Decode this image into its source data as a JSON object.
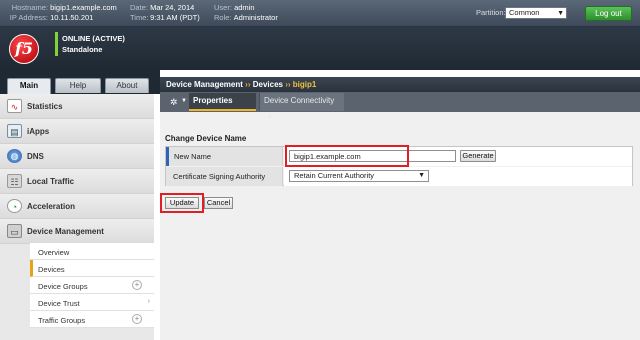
{
  "header": {
    "hostname_label": "Hostname:",
    "hostname": "bigip1.example.com",
    "ip_label": "IP Address:",
    "ip": "10.11.50.201",
    "date_label": "Date:",
    "date": "Mar 24, 2014",
    "time_label": "Time:",
    "time": "9:31 AM (PDT)",
    "user_label": "User:",
    "user": "admin",
    "role_label": "Role:",
    "role": "Administrator",
    "partition_label": "Partition:",
    "partition_value": "Common",
    "logout_label": "Log out"
  },
  "status": {
    "logo_text": "f5",
    "line1": "ONLINE (ACTIVE)",
    "line2": "Standalone"
  },
  "tabs": [
    {
      "label": "Main",
      "active": true
    },
    {
      "label": "Help",
      "active": false
    },
    {
      "label": "About",
      "active": false
    }
  ],
  "sidebar": {
    "items": [
      {
        "label": "Statistics",
        "icon": "chart-icon"
      },
      {
        "label": "iApps",
        "icon": "iapps-icon"
      },
      {
        "label": "DNS",
        "icon": "globe-icon"
      },
      {
        "label": "Local Traffic",
        "icon": "traffic-icon"
      },
      {
        "label": "Acceleration",
        "icon": "gauge-icon"
      },
      {
        "label": "Device Management",
        "icon": "device-icon"
      }
    ],
    "sub_items": [
      {
        "label": "Overview"
      },
      {
        "label": "Devices",
        "active": true
      },
      {
        "label": "Device Groups"
      },
      {
        "label": "Device Trust"
      },
      {
        "label": "Traffic Groups"
      }
    ]
  },
  "breadcrumb": {
    "part1": "Device Management",
    "sep": "››",
    "part2": "Devices",
    "current": "bigip1"
  },
  "subnav": {
    "properties": "Properties",
    "connectivity": "Device Connectivity"
  },
  "form": {
    "section_title": "Change Device Name",
    "new_name_label": "New Name",
    "new_name_value": "bigip1.example.com",
    "generate_label": "Generate",
    "csa_label": "Certificate Signing Authority",
    "csa_value": "Retain Current Authority",
    "update_label": "Update",
    "cancel_label": "Cancel"
  },
  "colors": {
    "highlight": "#e01e25",
    "accent": "#f0b52a",
    "status_ok": "#7fd43a"
  }
}
